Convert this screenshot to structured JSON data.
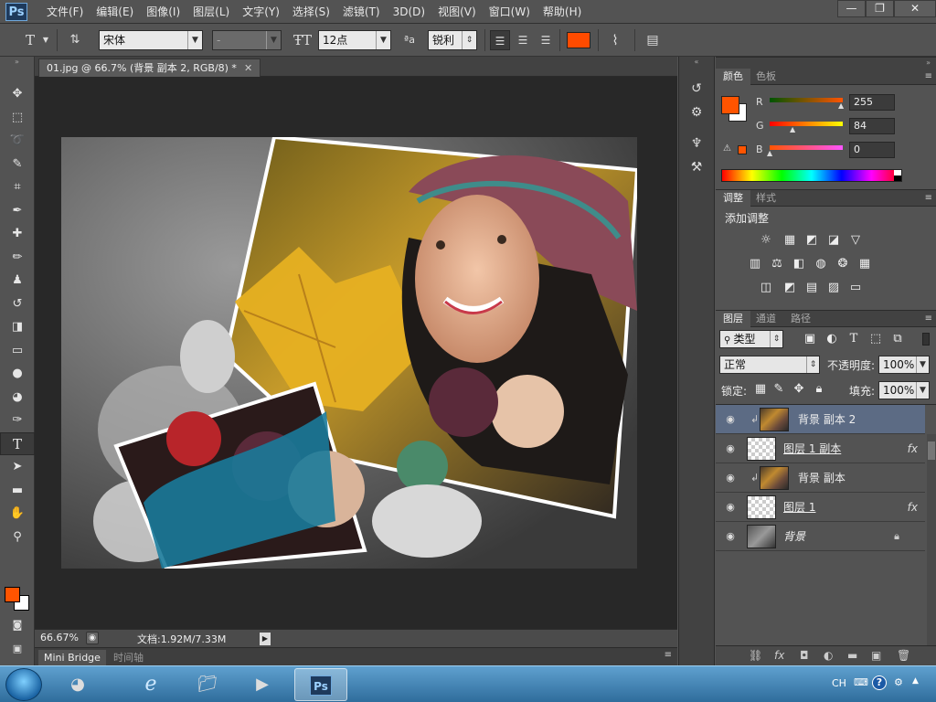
{
  "app": {
    "logo": "Ps"
  },
  "menu": [
    "文件(F)",
    "编辑(E)",
    "图像(I)",
    "图层(L)",
    "文字(Y)",
    "选择(S)",
    "滤镜(T)",
    "3D(D)",
    "视图(V)",
    "窗口(W)",
    "帮助(H)"
  ],
  "window_controls": {
    "minimize": "—",
    "restore": "❐",
    "close": "✕"
  },
  "options": {
    "font_family": "宋体",
    "font_style": "-",
    "font_size": "12点",
    "aa_label": "ªa",
    "antialias": "锐利",
    "text_color": "#ff4b00"
  },
  "document": {
    "tab_title": "01.jpg @ 66.7% (背景 副本 2, RGB/8) *",
    "zoom": "66.67%",
    "doc_info": "文档:1.92M/7.33M"
  },
  "bottom_tabs": [
    "Mini Bridge",
    "时间轴"
  ],
  "color_panel": {
    "tabs": [
      "颜色",
      "色板"
    ],
    "foreground": "#ff5400",
    "channels": [
      {
        "label": "R",
        "value": "255"
      },
      {
        "label": "G",
        "value": "84"
      },
      {
        "label": "B",
        "value": "0"
      }
    ]
  },
  "adjustments_panel": {
    "tabs": [
      "调整",
      "样式"
    ],
    "title": "添加调整"
  },
  "layers_panel": {
    "tabs": [
      "图层",
      "通道",
      "路径"
    ],
    "filter": "类型",
    "blend_mode": "正常",
    "opacity_label": "不透明度:",
    "opacity": "100%",
    "lock_label": "锁定:",
    "fill_label": "填充:",
    "fill": "100%",
    "layers": [
      {
        "name": "背景 副本 2",
        "selected": true,
        "fx": ""
      },
      {
        "name": "图层 1 副本",
        "selected": false,
        "fx": "fx"
      },
      {
        "name": "背景 副本",
        "selected": false,
        "fx": ""
      },
      {
        "name": "图层 1",
        "selected": false,
        "fx": "fx"
      },
      {
        "name": "背景",
        "selected": false,
        "fx": ""
      }
    ]
  },
  "taskbar": {
    "lang": "CH",
    "ps_label": "Ps"
  }
}
